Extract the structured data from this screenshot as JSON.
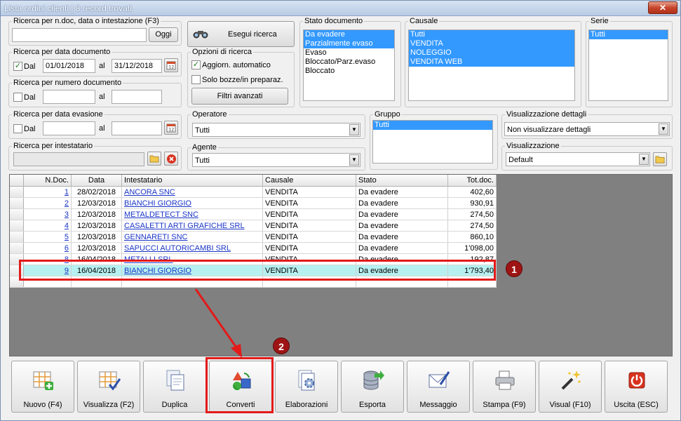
{
  "window": {
    "title": "Lista ordini clienti | 8 record trovati",
    "close_symbol": "✕"
  },
  "search_doc": {
    "legend": "Ricerca per n.doc, data o intestazione (F3)",
    "value": "",
    "button": "Oggi"
  },
  "search_button": {
    "label": "Esegui ricerca"
  },
  "date_doc": {
    "legend": "Ricerca per data documento",
    "dal_label": "Dal",
    "dal_checked": true,
    "check_mark": "✓",
    "from": "01/01/2018",
    "al_label": "al",
    "to": "31/12/2018"
  },
  "num_doc": {
    "legend": "Ricerca per numero documento",
    "dal_label": "Dal",
    "al_label": "al",
    "from": "",
    "to": ""
  },
  "options": {
    "legend": "Opzioni di ricerca",
    "auto_label": "Aggiorn. automatico",
    "check_mark": "✓",
    "drafts_label": "Solo bozze/in preparaz.",
    "advanced_button": "Filtri avanzati"
  },
  "stato_doc": {
    "legend": "Stato documento",
    "items": [
      {
        "label": "Da evadere",
        "selected": true
      },
      {
        "label": "Parzialmente evaso",
        "selected": true
      },
      {
        "label": "Evaso",
        "selected": false
      },
      {
        "label": "Bloccato/Parz.evaso",
        "selected": false
      },
      {
        "label": "Bloccato",
        "selected": false
      }
    ]
  },
  "causale": {
    "legend": "Causale",
    "items": [
      {
        "label": "Tutti",
        "selected": true
      },
      {
        "label": "VENDITA",
        "selected": true
      },
      {
        "label": "NOLEGGIO",
        "selected": true
      },
      {
        "label": "VENDITA WEB",
        "selected": true
      }
    ]
  },
  "serie": {
    "legend": "Serie",
    "items": [
      {
        "label": "Tutti",
        "selected": true
      }
    ]
  },
  "date_eva": {
    "legend": "Ricerca per data evasione",
    "dal_label": "Dal",
    "al_label": "al",
    "from": "",
    "to": ""
  },
  "operatore": {
    "legend": "Operatore",
    "value": "Tutti"
  },
  "gruppo": {
    "legend": "Gruppo",
    "items": [
      {
        "label": "Tutti",
        "selected": true
      }
    ]
  },
  "vis_dettagli": {
    "legend": "Visualizzazione dettagli",
    "value": "Non visualizzare dettagli"
  },
  "intestatario": {
    "legend": "Ricerca per intestatario",
    "value": ""
  },
  "agente": {
    "legend": "Agente",
    "value": "Tutti"
  },
  "visualizzazione": {
    "legend": "Visualizzazione",
    "value": "Default"
  },
  "dropdown_arrow": "▼",
  "grid": {
    "columns": [
      "N.Doc.",
      "Data",
      "Intestatario",
      "Causale",
      "Stato",
      "Tot.doc."
    ],
    "rows": [
      {
        "ndoc": "1",
        "data": "28/02/2018",
        "intestatario": "ANCORA SNC",
        "causale": "VENDITA",
        "stato": "Da evadere",
        "tot": "402,60"
      },
      {
        "ndoc": "2",
        "data": "12/03/2018",
        "intestatario": "BIANCHI GIORGIO",
        "causale": "VENDITA",
        "stato": "Da evadere",
        "tot": "930,91"
      },
      {
        "ndoc": "3",
        "data": "12/03/2018",
        "intestatario": "METALDETECT SNC",
        "causale": "VENDITA",
        "stato": "Da evadere",
        "tot": "274,50"
      },
      {
        "ndoc": "4",
        "data": "12/03/2018",
        "intestatario": "CASALETTI ARTI GRAFICHE SRL",
        "causale": "VENDITA",
        "stato": "Da evadere",
        "tot": "274,50"
      },
      {
        "ndoc": "5",
        "data": "12/03/2018",
        "intestatario": "GENNARETI SNC",
        "causale": "VENDITA",
        "stato": "Da evadere",
        "tot": "860,10"
      },
      {
        "ndoc": "6",
        "data": "12/03/2018",
        "intestatario": "SAPUCCI AUTORICAMBI SRL",
        "causale": "VENDITA",
        "stato": "Da evadere",
        "tot": "1'098,00"
      },
      {
        "ndoc": "8",
        "data": "16/04/2018",
        "intestatario": "METALLI SRL",
        "causale": "VENDITA",
        "stato": "Da evadere",
        "tot": "192,87"
      },
      {
        "ndoc": "9",
        "data": "16/04/2018",
        "intestatario": "BIANCHI GIORGIO",
        "causale": "VENDITA",
        "stato": "Da evadere",
        "tot": "1'793,40"
      }
    ]
  },
  "annotations": {
    "badge1": "1",
    "badge2": "2"
  },
  "toolbar": [
    {
      "label": "Nuovo (F4)",
      "icon": "new-grid-icon"
    },
    {
      "label": "Visualizza (F2)",
      "icon": "view-grid-icon"
    },
    {
      "label": "Duplica",
      "icon": "duplicate-icon"
    },
    {
      "label": "Converti",
      "icon": "convert-icon"
    },
    {
      "label": "Elaborazioni",
      "icon": "process-icon"
    },
    {
      "label": "Esporta",
      "icon": "export-icon"
    },
    {
      "label": "Messaggio",
      "icon": "message-icon"
    },
    {
      "label": "Stampa (F9)",
      "icon": "printer-icon"
    },
    {
      "label": "Visual (F10)",
      "icon": "magic-wand-icon"
    },
    {
      "label": "Uscita (ESC)",
      "icon": "exit-icon"
    }
  ],
  "colors": {
    "selection": "#3399ff",
    "highlight_row": "#b7f0f0",
    "annotation_red": "#e31a1a",
    "badge": "#9e1414"
  }
}
